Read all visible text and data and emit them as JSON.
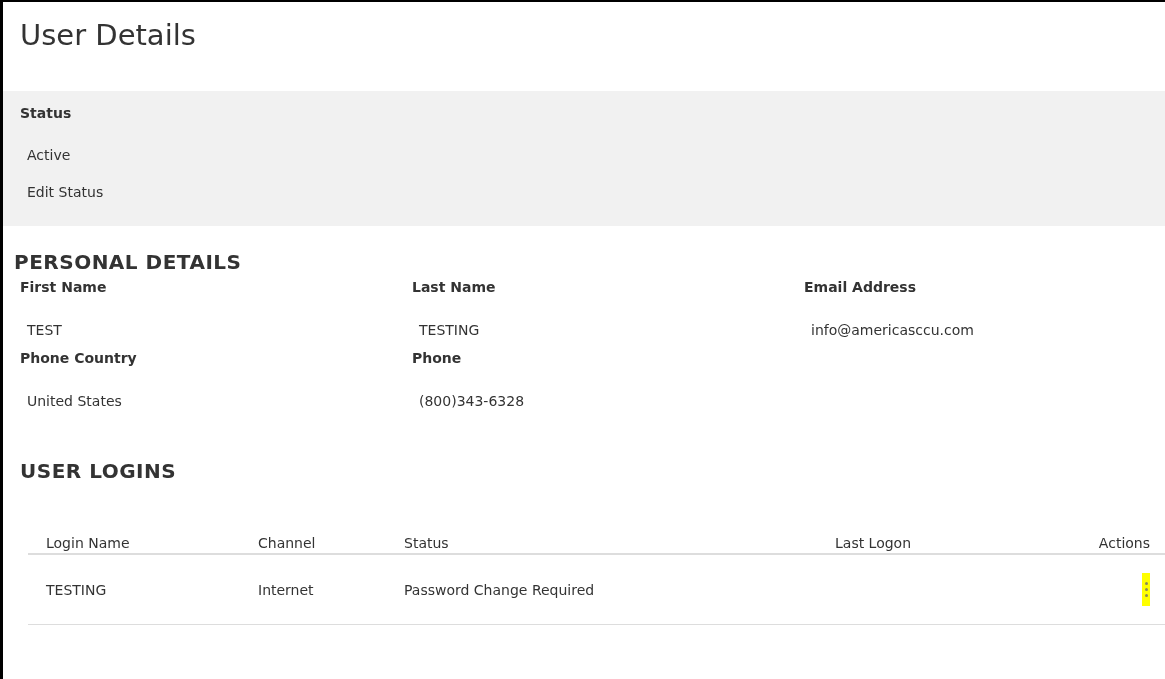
{
  "title": "User Details",
  "status_panel": {
    "label": "Status",
    "value": "Active",
    "edit_link": "Edit Status"
  },
  "personal_details": {
    "heading": "PERSONAL DETAILS",
    "fields": [
      {
        "label": "First Name",
        "value": "TEST"
      },
      {
        "label": "Last Name",
        "value": "TESTING"
      },
      {
        "label": "Email Address",
        "value": "info@americasccu.com"
      },
      {
        "label": "Phone Country",
        "value": "United States"
      },
      {
        "label": "Phone",
        "value": "(800)343-6328"
      }
    ]
  },
  "user_logins": {
    "heading": "USER LOGINS",
    "columns": [
      "Login Name",
      "Channel",
      "Status",
      "Last Logon",
      "Actions"
    ],
    "rows": [
      {
        "cells": [
          "TESTING",
          "Internet",
          "Password Change Required",
          null
        ],
        "actions_highlighted": true
      }
    ]
  }
}
